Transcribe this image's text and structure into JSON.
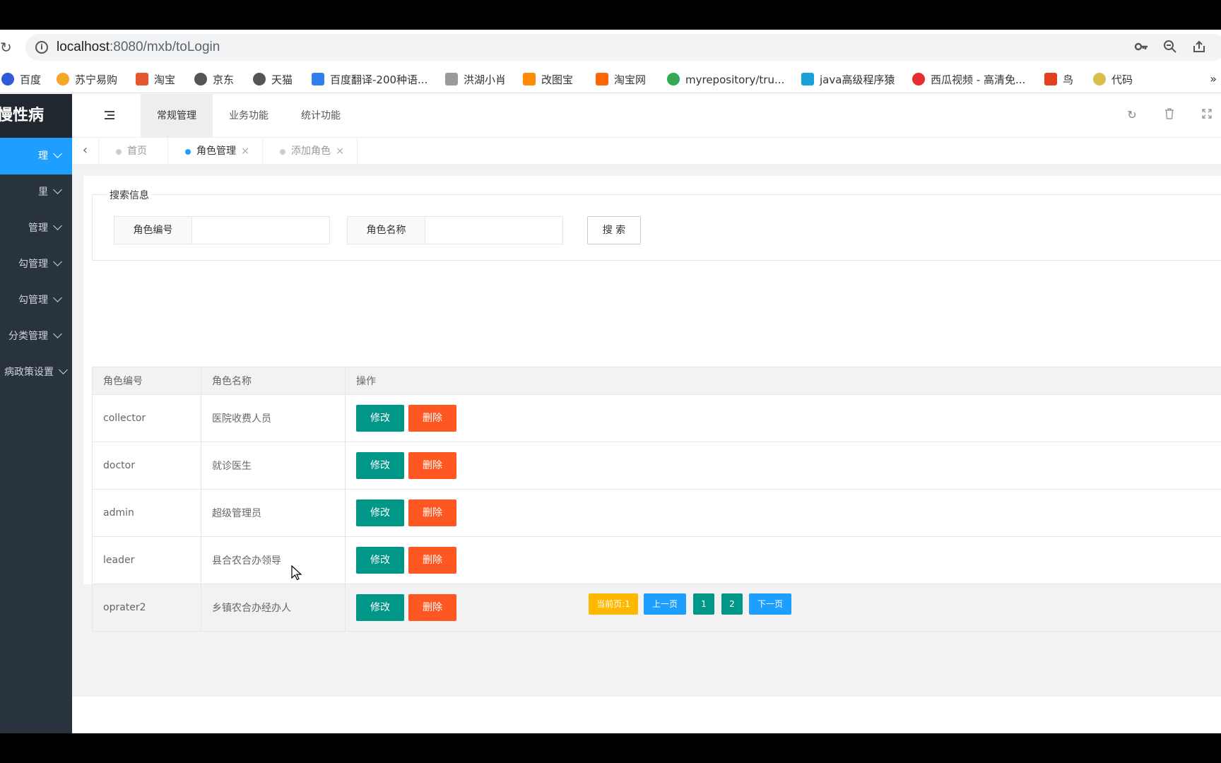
{
  "browser": {
    "url_host": "localhost",
    "url_rest": ":8080/mxb/toLogin",
    "bookmarks": [
      "百度",
      "苏宁易购",
      "淘宝",
      "京东",
      "天猫",
      "百度翻译-200种语...",
      "洪湖小肖",
      "改图宝",
      "淘宝网",
      "myrepository/tru...",
      "java高级程序猿",
      "西瓜视频 - 高清免...",
      "鸟",
      "代码"
    ],
    "bookmark_colors": [
      "#2e5bd8",
      "#f5a623",
      "#e4572e",
      "#555555",
      "#555555",
      "#2f80ed",
      "#7a7a7a",
      "#ff8c00",
      "#ff6600",
      "#34a853",
      "#1aa0d8",
      "#e62e2e",
      "#e04020",
      "#d8c050"
    ],
    "more": "»"
  },
  "sidebar": {
    "logo": "慢性病",
    "items": [
      {
        "label": "理"
      },
      {
        "label": "里"
      },
      {
        "label": "管理"
      },
      {
        "label": "勾管理"
      },
      {
        "label": "勾管理"
      },
      {
        "label": "分类管理"
      },
      {
        "label": "病政策设置"
      }
    ]
  },
  "header": {
    "tabs": [
      "常规管理",
      "业务功能",
      "统计功能"
    ],
    "icons": [
      "refresh-icon",
      "trash-icon",
      "fullscreen-icon"
    ]
  },
  "tabbar": {
    "tabs": [
      {
        "label": "首页",
        "closable": false
      },
      {
        "label": "角色管理",
        "closable": true
      },
      {
        "label": "添加角色",
        "closable": true
      }
    ],
    "close_glyph": "×"
  },
  "search": {
    "legend": "搜索信息",
    "field1_label": "角色编号",
    "field2_label": "角色名称",
    "button": "搜 索"
  },
  "table": {
    "headers": [
      "角色编号",
      "角色名称",
      "操作"
    ],
    "rows": [
      {
        "code": "collector",
        "name": "医院收费人员"
      },
      {
        "code": "doctor",
        "name": "就诊医生"
      },
      {
        "code": "admin",
        "name": "超级管理员"
      },
      {
        "code": "leader",
        "name": "县合农合办领导"
      },
      {
        "code": "oprater2",
        "name": "乡镇农合办经办人"
      }
    ],
    "edit_label": "修改",
    "delete_label": "删除"
  },
  "pager": {
    "current": "当前页:1",
    "prev": "上一页",
    "pages": [
      "1",
      "2"
    ],
    "next": "下一页"
  },
  "colors": {
    "accent": "#1e9fff",
    "edit": "#009688",
    "delete": "#ff5722",
    "current_page": "#ffb800",
    "sidebar_bg": "#28333e"
  }
}
